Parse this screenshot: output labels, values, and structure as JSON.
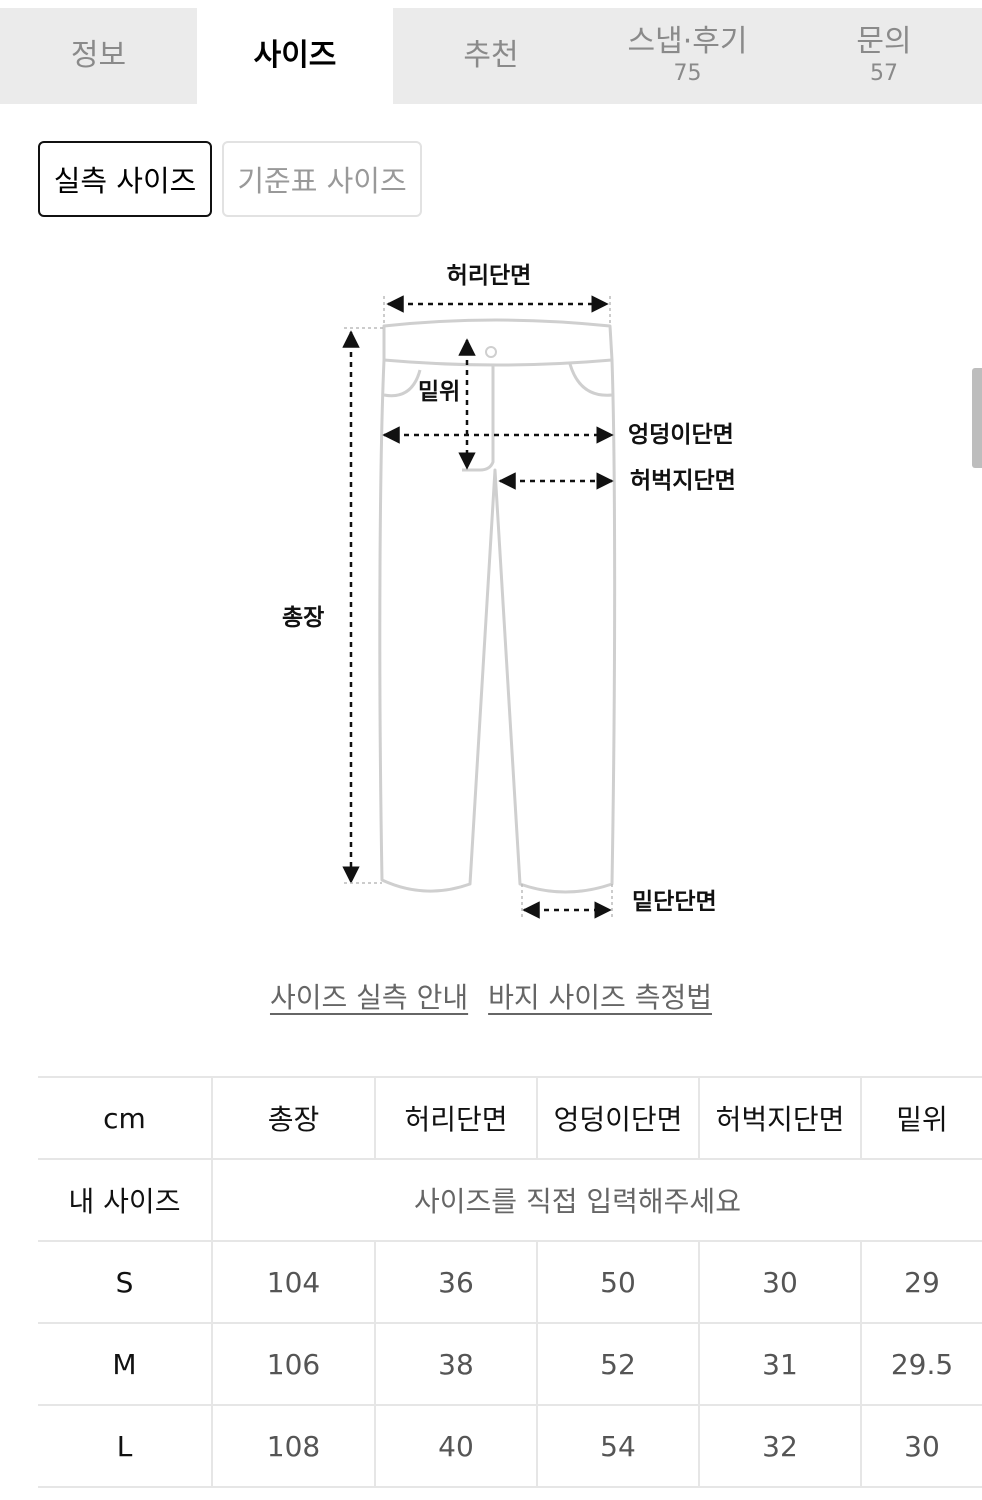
{
  "tabs": [
    {
      "label": "정보",
      "count": ""
    },
    {
      "label": "사이즈",
      "count": ""
    },
    {
      "label": "추천",
      "count": ""
    },
    {
      "label": "스냅·후기",
      "count": "75"
    },
    {
      "label": "문의",
      "count": "57"
    }
  ],
  "active_tab": "사이즈",
  "segments": {
    "actual": "실측 사이즈",
    "standard": "기준표 사이즈"
  },
  "diagram": {
    "waist": "허리단면",
    "rise": "밑위",
    "hip": "엉덩이단면",
    "thigh": "허벅지단면",
    "length": "총장",
    "hem": "밑단단면"
  },
  "links": {
    "guide": "사이즈 실측 안내",
    "method": "바지 사이즈 측정법"
  },
  "table": {
    "headers": [
      "cm",
      "총장",
      "허리단면",
      "엉덩이단면",
      "허벅지단면",
      "밑위"
    ],
    "my_size_label": "내 사이즈",
    "my_size_hint": "사이즈를 직접 입력해주세요",
    "rows": [
      {
        "size": "S",
        "values": [
          "104",
          "36",
          "50",
          "30",
          "29"
        ]
      },
      {
        "size": "M",
        "values": [
          "106",
          "38",
          "52",
          "31",
          "29.5"
        ]
      },
      {
        "size": "L",
        "values": [
          "108",
          "40",
          "54",
          "32",
          "30"
        ]
      }
    ]
  }
}
